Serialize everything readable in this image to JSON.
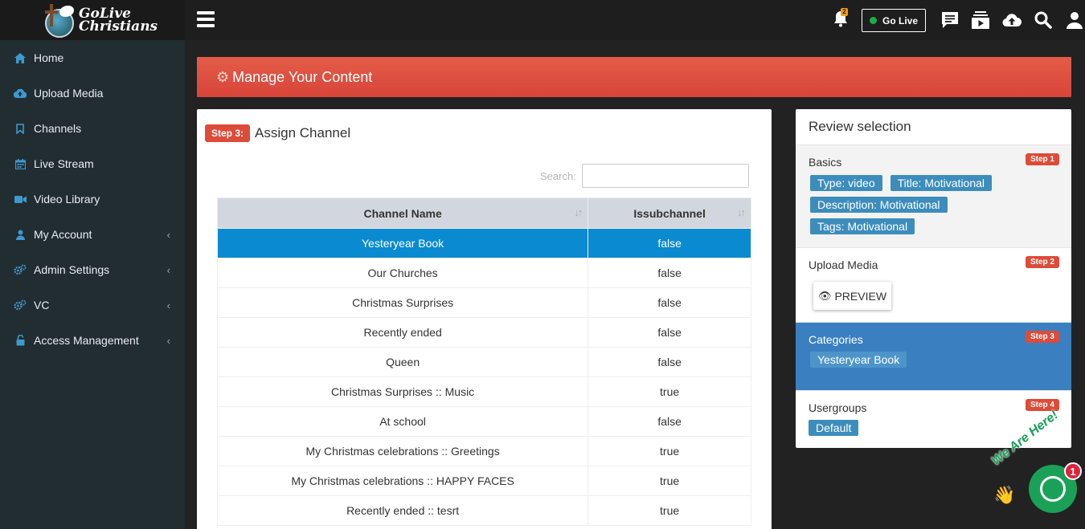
{
  "brand": {
    "name_line1": "GoLive",
    "name_line2": "Christians"
  },
  "sidebar": {
    "items": [
      {
        "label": "Home",
        "icon": "home-icon",
        "has_chevron": false
      },
      {
        "label": "Upload Media",
        "icon": "cloud-upload-icon",
        "has_chevron": false
      },
      {
        "label": "Channels",
        "icon": "bookmark-icon",
        "has_chevron": false
      },
      {
        "label": "Live Stream",
        "icon": "calendar-icon",
        "has_chevron": false
      },
      {
        "label": "Video Library",
        "icon": "video-camera-icon",
        "has_chevron": false
      },
      {
        "label": "My Account",
        "icon": "user-icon",
        "has_chevron": true
      },
      {
        "label": "Admin Settings",
        "icon": "gears-icon",
        "has_chevron": true
      },
      {
        "label": "VC",
        "icon": "gears-icon",
        "has_chevron": true
      },
      {
        "label": "Access Management",
        "icon": "unlock-icon",
        "has_chevron": true
      }
    ]
  },
  "topbar": {
    "notification_count": "2",
    "go_live_label": "Go Live"
  },
  "banner": {
    "title": "Manage Your Content"
  },
  "step": {
    "label": "Step 3:",
    "title": "Assign Channel"
  },
  "search": {
    "label": "Search:",
    "value": ""
  },
  "table": {
    "headers": [
      "Channel Name",
      "Issubchannel"
    ],
    "rows": [
      {
        "name": "Yesteryear Book",
        "sub": "false",
        "selected": true
      },
      {
        "name": "Our Churches",
        "sub": "false",
        "selected": false
      },
      {
        "name": "Christmas Surprises",
        "sub": "false",
        "selected": false
      },
      {
        "name": "Recently ended",
        "sub": "false",
        "selected": false
      },
      {
        "name": "Queen",
        "sub": "false",
        "selected": false
      },
      {
        "name": "Christmas Surprises :: Music",
        "sub": "true",
        "selected": false
      },
      {
        "name": "At school",
        "sub": "false",
        "selected": false
      },
      {
        "name": "My Christmas celebrations :: Greetings",
        "sub": "true",
        "selected": false
      },
      {
        "name": "My Christmas celebrations :: HAPPY FACES",
        "sub": "true",
        "selected": false
      },
      {
        "name": "Recently ended :: tesrt",
        "sub": "true",
        "selected": false
      }
    ]
  },
  "review": {
    "title": "Review selection",
    "basics": {
      "name": "Basics",
      "step": "Step 1",
      "tags": [
        "Type: video",
        "Title: Motivational",
        "Description: Motivational",
        "Tags: Motivational"
      ]
    },
    "upload": {
      "name": "Upload Media",
      "step": "Step 2",
      "preview_label": "PREVIEW"
    },
    "categories": {
      "name": "Categories",
      "step": "Step 3",
      "tags": [
        "Yesteryear Book"
      ]
    },
    "usergroups": {
      "name": "Usergroups",
      "step": "Step 4",
      "tags": [
        "Default"
      ]
    }
  },
  "chat": {
    "tagline": "We Are Here!",
    "badge": "1"
  },
  "colors": {
    "accent_red": "#dd4b39",
    "selected_blue": "#0a8ad0",
    "active_section": "#3a80c0",
    "chat_green": "#1aa157"
  }
}
